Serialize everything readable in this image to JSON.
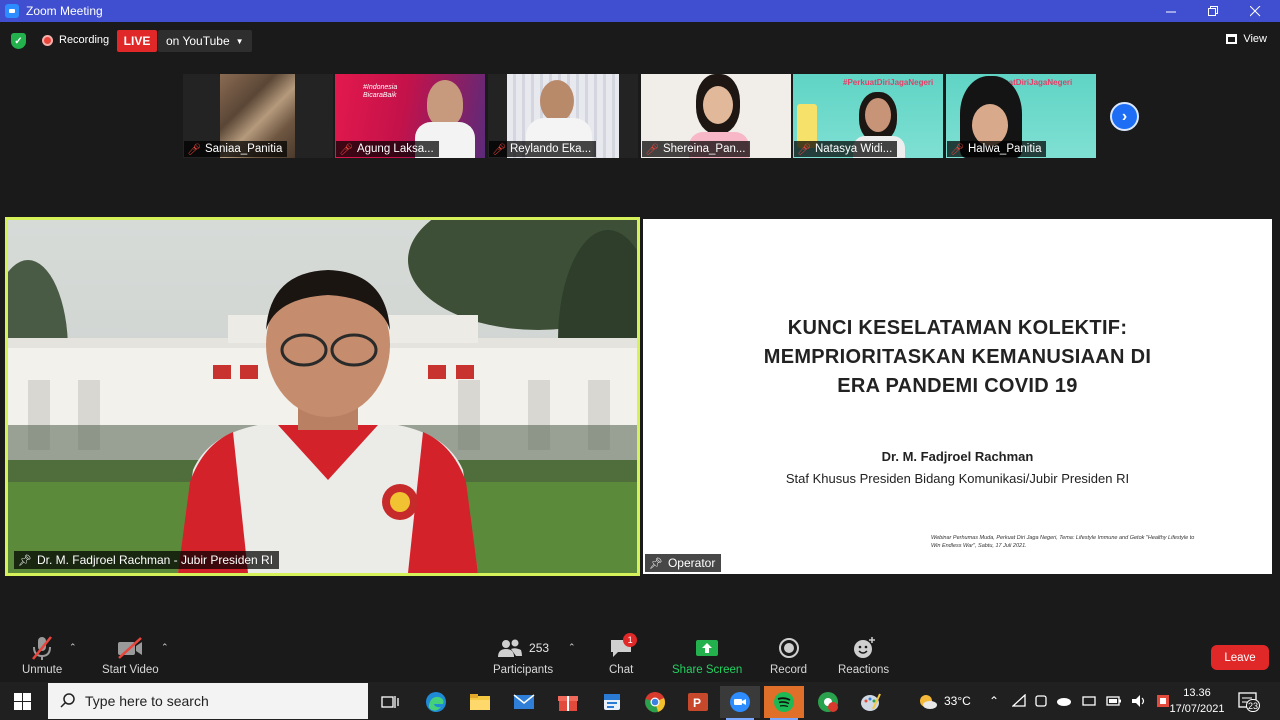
{
  "window": {
    "title": "Zoom Meeting"
  },
  "topbar": {
    "recording_label": "Recording",
    "live_label": "LIVE",
    "stream_label": "on YouTube",
    "view_label": "View"
  },
  "thumbnails": [
    {
      "name": "Saniaa_Panitia"
    },
    {
      "name": "Agung Laksa..."
    },
    {
      "name": "Reylando Eka..."
    },
    {
      "name": "Shereina_Pan..."
    },
    {
      "name": "Natasya Widi..."
    },
    {
      "name": "Halwa_Panitia"
    }
  ],
  "thumb_texts": {
    "agung_banner": "#Indonesia BicaraBaik",
    "natasya_banner": "#PerkuatDiriJagaNegeri",
    "halwa_banner": "#PerkuatDiriJagaNegeri"
  },
  "speaker": {
    "name": "Dr. M. Fadjroel Rachman - Jubir Presiden RI"
  },
  "share": {
    "name": "Operator",
    "slide_title_lines": [
      "KUNCI KESELATAMAN KOLEKTIF:",
      "MEMPRIORITASKAN KEMANUSIAAN DI",
      "ERA PANDEMI COVID 19"
    ],
    "slide_name": "Dr. M. Fadjroel Rachman",
    "slide_role": "Staf Khusus Presiden Bidang Komunikasi/Jubir Presiden RI",
    "slide_footer": "Webinar Perhumas Muda, Perkuat Diri Jaga Negeri, Tema: Lifestyle Immune and Getok \"Healthy Lifestyle to Win Endless War\", Sabtu, 17 Juli 2021."
  },
  "controls": {
    "unmute": "Unmute",
    "start_video": "Start Video",
    "participants": "Participants",
    "participants_count": "253",
    "chat": "Chat",
    "chat_badge": "1",
    "share_screen": "Share Screen",
    "record": "Record",
    "reactions": "Reactions",
    "leave": "Leave"
  },
  "taskbar": {
    "search_placeholder": "Type here to search",
    "temperature": "33°C",
    "time": "13.36",
    "date": "17/07/2021",
    "notification_count": "23"
  },
  "colors": {
    "titlebar": "#3f4fd0",
    "live": "#e02828",
    "active_speaker_border": "#d6f25a",
    "share_green": "#23b14d",
    "leave": "#e02828"
  }
}
